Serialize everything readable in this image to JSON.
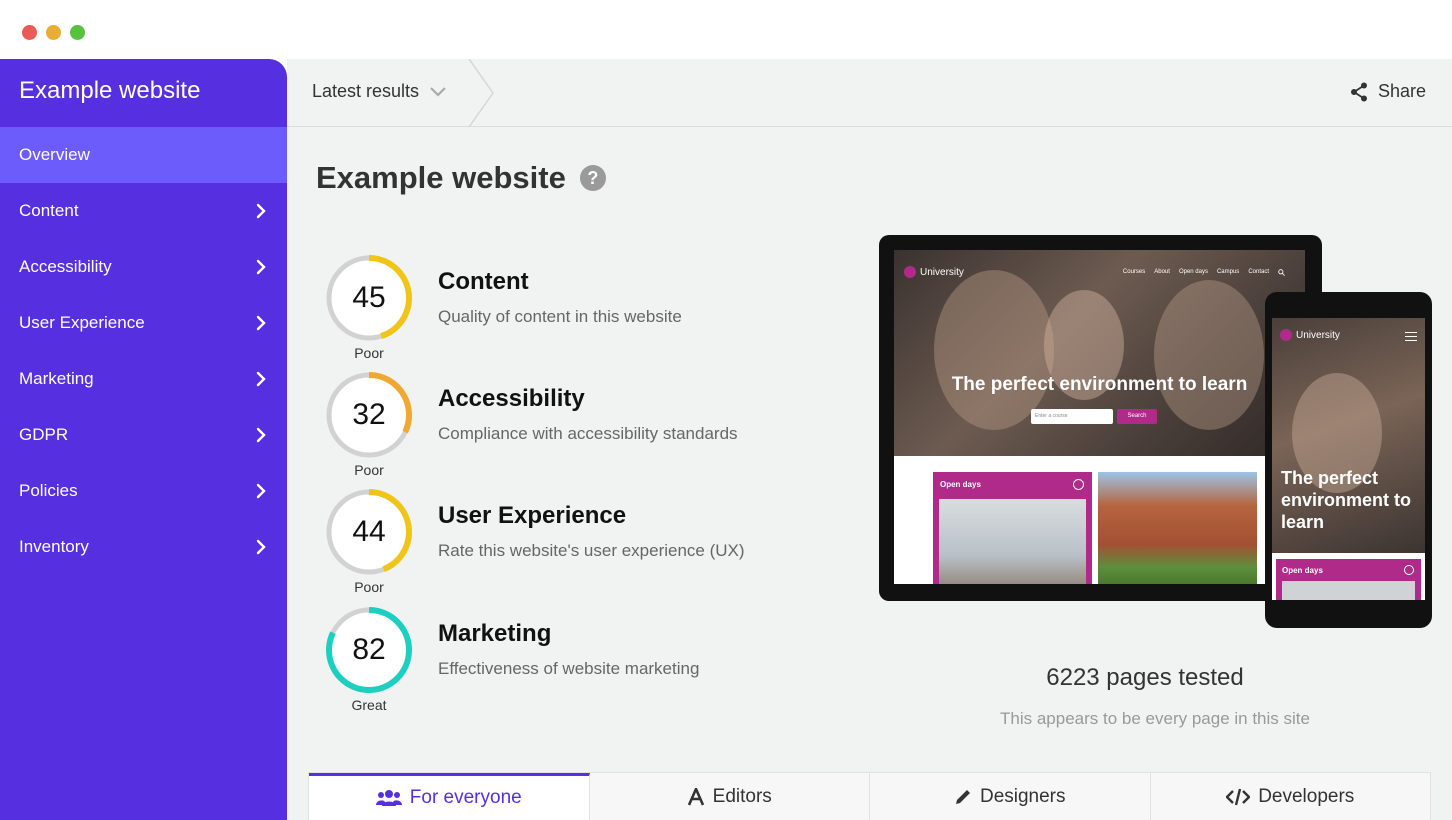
{
  "window": {
    "controls": [
      "close",
      "minimize",
      "maximize"
    ]
  },
  "sidebar": {
    "title": "Example website",
    "items": [
      {
        "label": "Overview",
        "active": true
      },
      {
        "label": "Content"
      },
      {
        "label": "Accessibility"
      },
      {
        "label": "User Experience"
      },
      {
        "label": "Marketing"
      },
      {
        "label": "GDPR"
      },
      {
        "label": "Policies"
      },
      {
        "label": "Inventory"
      }
    ]
  },
  "topbar": {
    "results_label": "Latest results",
    "share_label": "Share"
  },
  "page": {
    "title": "Example website"
  },
  "scores": [
    {
      "value": "45",
      "rating": "Poor",
      "title": "Content",
      "desc": "Quality of content in this website",
      "fraction": 0.45,
      "color": "#f0c419"
    },
    {
      "value": "32",
      "rating": "Poor",
      "title": "Accessibility",
      "desc": "Compliance with accessibility standards",
      "fraction": 0.32,
      "color": "#f0a830"
    },
    {
      "value": "44",
      "rating": "Poor",
      "title": "User Experience",
      "desc": "Rate this website's user experience (UX)",
      "fraction": 0.44,
      "color": "#f0c419"
    },
    {
      "value": "82",
      "rating": "Great",
      "title": "Marketing",
      "desc": "Effectiveness of website marketing",
      "fraction": 0.82,
      "color": "#1dcfc0"
    }
  ],
  "preview": {
    "logo": "University",
    "nav": [
      "Courses",
      "About",
      "Open days",
      "Campus",
      "Contact"
    ],
    "hero": "The perfect environment to learn",
    "search_placeholder": "Enter a course",
    "search_button": "Search",
    "card_label": "Open days",
    "mobile_hero": "The perfect environment to learn",
    "mobile_card_label": "Open days"
  },
  "summary": {
    "pages_tested": "6223 pages tested",
    "note": "This appears to be every page in this site"
  },
  "tabs": [
    {
      "label": "For everyone",
      "icon": "users-icon",
      "active": true
    },
    {
      "label": "Editors",
      "icon": "font-icon"
    },
    {
      "label": "Designers",
      "icon": "pencil-icon"
    },
    {
      "label": "Developers",
      "icon": "code-icon"
    }
  ],
  "colors": {
    "brand": "#5630e0",
    "sidebar_active": "#6b5cfb",
    "preview_accent": "#b02a8a",
    "poor": "#f0c419",
    "great": "#1dcfc0"
  }
}
